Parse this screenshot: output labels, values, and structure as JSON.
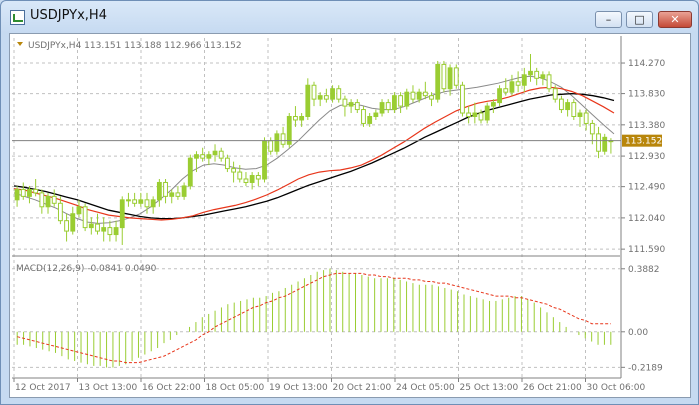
{
  "window": {
    "title": "USDJPYx,H4",
    "minimize_glyph": "–",
    "maximize_glyph": "□",
    "close_glyph": "✕"
  },
  "header": {
    "symbol_label": "USDJPYx,H4  113.151 113.188 112.966 113.152"
  },
  "macd": {
    "label": "MACD(12,26,9) -0.0841 0.0490"
  },
  "current_price": "113.152",
  "colors": {
    "bull": "#9acd32",
    "bear": "#9acd32",
    "grid": "#c0c0c0",
    "axis_text": "#707070",
    "fast_ma": "#e8361b",
    "slow_ma": "#000000",
    "signal": "#e8361b",
    "price_tag": "#b8860b",
    "window_border": "#6f8fb6"
  },
  "icons": {
    "app": "chart-window-icon",
    "minimize": "minimize-icon",
    "maximize": "maximize-icon",
    "close": "close-icon"
  },
  "chart_data": [
    {
      "type": "candlestick",
      "price_axis": {
        "ticks": [
          "114.270",
          "113.830",
          "113.380",
          "112.930",
          "112.490",
          "112.040",
          "111.590"
        ],
        "values": [
          114.27,
          113.83,
          113.38,
          112.93,
          112.49,
          112.04,
          111.59
        ],
        "range": [
          111.52,
          114.4
        ]
      },
      "time_axis": {
        "labels": [
          "12 Oct 2017",
          "13 Oct 13:00",
          "16 Oct 22:00",
          "18 Oct 05:00",
          "19 Oct 13:00",
          "20 Oct 21:00",
          "24 Oct 05:00",
          "25 Oct 13:00",
          "26 Oct 21:00",
          "30 Oct 06:00"
        ]
      },
      "ohlc": [
        [
          112.3,
          112.5,
          112.2,
          112.45
        ],
        [
          112.45,
          112.55,
          112.3,
          112.35
        ],
        [
          112.35,
          112.5,
          112.25,
          112.45
        ],
        [
          112.45,
          112.6,
          112.35,
          112.4
        ],
        [
          112.4,
          112.45,
          112.1,
          112.2
        ],
        [
          112.2,
          112.4,
          112.1,
          112.35
        ],
        [
          112.35,
          112.45,
          112.2,
          112.25
        ],
        [
          112.25,
          112.35,
          111.95,
          112.0
        ],
        [
          112.0,
          112.1,
          111.7,
          111.85
        ],
        [
          111.85,
          112.2,
          111.8,
          112.1
        ],
        [
          112.1,
          112.3,
          112.05,
          112.2
        ],
        [
          112.2,
          112.25,
          111.85,
          111.9
        ],
        [
          111.9,
          112.05,
          111.8,
          111.95
        ],
        [
          111.95,
          112.1,
          111.8,
          111.85
        ],
        [
          111.85,
          112.05,
          111.7,
          111.9
        ],
        [
          111.9,
          112.0,
          111.7,
          111.8
        ],
        [
          111.8,
          112.0,
          111.7,
          111.9
        ],
        [
          111.9,
          112.35,
          111.65,
          112.3
        ],
        [
          112.3,
          112.4,
          112.2,
          112.3
        ],
        [
          112.3,
          112.4,
          112.2,
          112.25
        ],
        [
          112.25,
          112.4,
          112.2,
          112.3
        ],
        [
          112.3,
          112.4,
          112.1,
          112.2
        ],
        [
          112.2,
          112.35,
          112.1,
          112.3
        ],
        [
          112.3,
          112.6,
          112.2,
          112.55
        ],
        [
          112.55,
          112.6,
          112.25,
          112.35
        ],
        [
          112.35,
          112.45,
          112.25,
          112.4
        ],
        [
          112.4,
          112.5,
          112.3,
          112.35
        ],
        [
          112.35,
          112.55,
          112.3,
          112.5
        ],
        [
          112.5,
          112.95,
          112.45,
          112.9
        ],
        [
          112.9,
          113.0,
          112.7,
          112.95
        ],
        [
          112.95,
          113.05,
          112.85,
          112.9
        ],
        [
          112.9,
          113.0,
          112.8,
          112.95
        ],
        [
          112.95,
          113.1,
          112.85,
          113.0
        ],
        [
          113.0,
          113.05,
          112.85,
          112.9
        ],
        [
          112.9,
          112.95,
          112.7,
          112.75
        ],
        [
          112.75,
          112.85,
          112.55,
          112.7
        ],
        [
          112.7,
          112.8,
          112.55,
          112.6
        ],
        [
          112.6,
          112.7,
          112.5,
          112.55
        ],
        [
          112.55,
          112.7,
          112.45,
          112.65
        ],
        [
          112.65,
          112.7,
          112.5,
          112.6
        ],
        [
          112.6,
          113.2,
          112.55,
          113.15
        ],
        [
          113.15,
          113.2,
          112.95,
          113.0
        ],
        [
          113.0,
          113.3,
          112.95,
          113.25
        ],
        [
          113.25,
          113.35,
          113.05,
          113.1
        ],
        [
          113.1,
          113.55,
          113.05,
          113.5
        ],
        [
          113.5,
          113.65,
          113.35,
          113.45
        ],
        [
          113.45,
          113.55,
          113.35,
          113.5
        ],
        [
          113.5,
          114.05,
          113.45,
          113.95
        ],
        [
          113.95,
          114.0,
          113.65,
          113.75
        ],
        [
          113.75,
          113.85,
          113.65,
          113.8
        ],
        [
          113.8,
          113.9,
          113.7,
          113.75
        ],
        [
          113.75,
          113.95,
          113.7,
          113.9
        ],
        [
          113.9,
          113.95,
          113.7,
          113.75
        ],
        [
          113.75,
          113.8,
          113.5,
          113.65
        ],
        [
          113.65,
          113.75,
          113.55,
          113.7
        ],
        [
          113.7,
          113.75,
          113.55,
          113.6
        ],
        [
          113.6,
          113.65,
          113.35,
          113.4
        ],
        [
          113.4,
          113.55,
          113.35,
          113.5
        ],
        [
          113.5,
          113.6,
          113.45,
          113.55
        ],
        [
          113.55,
          113.75,
          113.5,
          113.7
        ],
        [
          113.7,
          113.75,
          113.55,
          113.6
        ],
        [
          113.6,
          113.85,
          113.55,
          113.8
        ],
        [
          113.8,
          113.85,
          113.55,
          113.65
        ],
        [
          113.65,
          113.9,
          113.6,
          113.85
        ],
        [
          113.85,
          113.95,
          113.7,
          113.75
        ],
        [
          113.75,
          113.9,
          113.7,
          113.85
        ],
        [
          113.85,
          114.0,
          113.75,
          113.8
        ],
        [
          113.8,
          113.85,
          113.65,
          113.75
        ],
        [
          113.75,
          114.3,
          113.7,
          114.25
        ],
        [
          114.25,
          114.3,
          113.85,
          113.9
        ],
        [
          113.9,
          114.25,
          113.8,
          114.2
        ],
        [
          114.2,
          114.25,
          113.9,
          113.95
        ],
        [
          113.95,
          114.0,
          113.5,
          113.55
        ],
        [
          113.55,
          113.65,
          113.4,
          113.5
        ],
        [
          113.5,
          113.7,
          113.4,
          113.55
        ],
        [
          113.55,
          113.6,
          113.4,
          113.45
        ],
        [
          113.45,
          113.7,
          113.4,
          113.65
        ],
        [
          113.65,
          113.75,
          113.55,
          113.7
        ],
        [
          113.7,
          113.95,
          113.65,
          113.9
        ],
        [
          113.9,
          114.05,
          113.8,
          113.85
        ],
        [
          113.85,
          114.1,
          113.8,
          114.0
        ],
        [
          114.0,
          114.15,
          113.85,
          113.95
        ],
        [
          113.95,
          114.2,
          113.85,
          114.1
        ],
        [
          114.1,
          114.4,
          114.0,
          114.15
        ],
        [
          114.15,
          114.2,
          113.95,
          114.05
        ],
        [
          114.05,
          114.15,
          113.95,
          114.1
        ],
        [
          114.1,
          114.15,
          113.85,
          113.9
        ],
        [
          113.9,
          113.95,
          113.7,
          113.75
        ],
        [
          113.75,
          113.8,
          113.55,
          113.6
        ],
        [
          113.6,
          113.75,
          113.5,
          113.7
        ],
        [
          113.7,
          113.75,
          113.45,
          113.5
        ],
        [
          113.5,
          113.6,
          113.35,
          113.55
        ],
        [
          113.55,
          113.6,
          113.3,
          113.4
        ],
        [
          113.4,
          113.45,
          113.1,
          113.25
        ],
        [
          113.25,
          113.35,
          112.9,
          113.0
        ],
        [
          113.0,
          113.25,
          112.95,
          113.2
        ],
        [
          113.151,
          113.188,
          112.966,
          113.152
        ]
      ],
      "ma_fast": [
        112.46,
        112.44,
        112.4,
        112.36,
        112.32,
        112.27,
        112.22,
        112.16,
        112.12,
        112.08,
        112.06,
        112.04,
        112.03,
        112.02,
        112.01,
        112.02,
        112.04,
        112.07,
        112.12,
        112.16,
        112.19,
        112.22,
        112.26,
        112.31,
        112.37,
        112.44,
        112.52,
        112.6,
        112.66,
        112.7,
        112.72,
        112.73,
        112.76,
        112.8,
        112.87,
        112.95,
        113.04,
        113.13,
        113.23,
        113.33,
        113.42,
        113.5,
        113.58,
        113.64,
        113.69,
        113.72,
        113.74,
        113.78,
        113.83,
        113.88,
        113.91,
        113.92,
        113.9,
        113.86,
        113.8,
        113.72,
        113.64,
        113.55
      ],
      "ma_slow": [
        112.5,
        112.48,
        112.45,
        112.42,
        112.38,
        112.34,
        112.3,
        112.25,
        112.2,
        112.15,
        112.12,
        112.09,
        112.06,
        112.04,
        112.03,
        112.03,
        112.04,
        112.06,
        112.08,
        112.11,
        112.14,
        112.17,
        112.2,
        112.24,
        112.28,
        112.33,
        112.39,
        112.45,
        112.51,
        112.56,
        112.61,
        112.66,
        112.71,
        112.77,
        112.83,
        112.9,
        112.97,
        113.04,
        113.12,
        113.2,
        113.27,
        113.34,
        113.41,
        113.48,
        113.54,
        113.59,
        113.63,
        113.67,
        113.71,
        113.75,
        113.78,
        113.81,
        113.82,
        113.83,
        113.82,
        113.8,
        113.77,
        113.73
      ],
      "ma_mid": [
        112.4,
        112.35,
        112.3,
        112.24,
        112.18,
        112.1,
        112.03,
        111.98,
        111.96,
        111.97,
        112.0,
        112.04,
        112.1,
        112.2,
        112.32,
        112.45,
        112.6,
        112.72,
        112.8,
        112.82,
        112.8,
        112.76,
        112.74,
        112.75,
        112.8,
        112.9,
        113.02,
        113.15,
        113.3,
        113.45,
        113.58,
        113.66,
        113.68,
        113.66,
        113.62,
        113.6,
        113.6,
        113.64,
        113.7,
        113.76,
        113.82,
        113.86,
        113.88,
        113.9,
        113.92,
        113.95,
        113.98,
        114.02,
        114.06,
        114.08,
        114.06,
        114.0,
        113.92,
        113.8,
        113.66,
        113.52,
        113.38,
        113.25
      ]
    },
    {
      "type": "bar",
      "title": "MACD(12,26,9) -0.0841 0.0490",
      "y_axis": {
        "ticks": [
          "0.3882",
          "0.00",
          "-0.2189"
        ],
        "values": [
          0.3882,
          0.0,
          -0.2189
        ],
        "range": [
          -0.26,
          0.43
        ]
      },
      "histogram": [
        -0.08,
        -0.08,
        -0.09,
        -0.1,
        -0.11,
        -0.12,
        -0.13,
        -0.15,
        -0.17,
        -0.18,
        -0.19,
        -0.2,
        -0.21,
        -0.21,
        -0.22,
        -0.22,
        -0.21,
        -0.2,
        -0.18,
        -0.16,
        -0.14,
        -0.12,
        -0.1,
        -0.07,
        -0.05,
        -0.02,
        0.0,
        0.03,
        0.06,
        0.09,
        0.11,
        0.13,
        0.15,
        0.17,
        0.18,
        0.19,
        0.2,
        0.21,
        0.21,
        0.22,
        0.24,
        0.25,
        0.27,
        0.29,
        0.31,
        0.33,
        0.35,
        0.37,
        0.38,
        0.39,
        0.38,
        0.37,
        0.36,
        0.36,
        0.35,
        0.34,
        0.33,
        0.33,
        0.33,
        0.33,
        0.32,
        0.31,
        0.3,
        0.29,
        0.29,
        0.29,
        0.28,
        0.27,
        0.26,
        0.25,
        0.23,
        0.22,
        0.21,
        0.2,
        0.19,
        0.19,
        0.2,
        0.21,
        0.22,
        0.22,
        0.2,
        0.18,
        0.15,
        0.12,
        0.09,
        0.06,
        0.03,
        0.0,
        -0.02,
        -0.04,
        -0.06,
        -0.08,
        -0.08,
        -0.08
      ],
      "signal": [
        -0.03,
        -0.04,
        -0.05,
        -0.06,
        -0.07,
        -0.08,
        -0.09,
        -0.1,
        -0.11,
        -0.12,
        -0.13,
        -0.14,
        -0.15,
        -0.16,
        -0.17,
        -0.18,
        -0.18,
        -0.19,
        -0.19,
        -0.19,
        -0.18,
        -0.17,
        -0.16,
        -0.15,
        -0.13,
        -0.11,
        -0.09,
        -0.07,
        -0.05,
        -0.02,
        0.0,
        0.03,
        0.05,
        0.07,
        0.09,
        0.11,
        0.13,
        0.15,
        0.16,
        0.18,
        0.19,
        0.21,
        0.22,
        0.24,
        0.26,
        0.28,
        0.3,
        0.32,
        0.34,
        0.35,
        0.36,
        0.36,
        0.36,
        0.36,
        0.36,
        0.35,
        0.35,
        0.34,
        0.34,
        0.33,
        0.33,
        0.33,
        0.32,
        0.32,
        0.31,
        0.31,
        0.3,
        0.3,
        0.29,
        0.28,
        0.27,
        0.26,
        0.25,
        0.24,
        0.23,
        0.22,
        0.22,
        0.22,
        0.21,
        0.21,
        0.2,
        0.19,
        0.18,
        0.17,
        0.15,
        0.14,
        0.12,
        0.1,
        0.08,
        0.07,
        0.05,
        0.05,
        0.05,
        0.049
      ]
    }
  ]
}
